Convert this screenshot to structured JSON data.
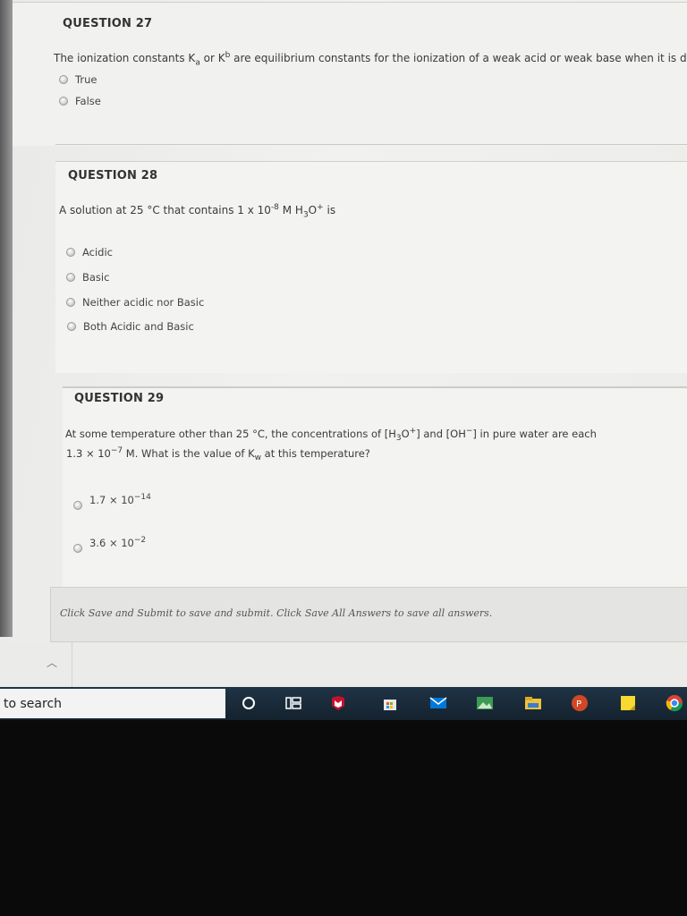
{
  "q27": {
    "title": "QUESTION 27",
    "text_a": "The ionization constants K",
    "sub_a": "a",
    "text_or": " or K",
    "sub_b": "b",
    "text_b": " are equilibrium constants for the ionization of a weak  acid or weak base when it is dissolv",
    "options": [
      "True",
      "False"
    ]
  },
  "q28": {
    "title": "QUESTION 28",
    "text_a": "A solution at 25 °C that contains 1 x 10",
    "exp": "-8",
    "text_b": "  M H",
    "sub": "3",
    "text_c": "O",
    "sup": "+",
    "text_d": " is",
    "options": [
      "Acidic",
      "Basic",
      "Neither acidic nor Basic",
      "Both Acidic and Basic"
    ]
  },
  "q29": {
    "title": "QUESTION 29",
    "line1_a": "At some temperature other than 25 °C, the concentrations of [H",
    "line1_sub": "3",
    "line1_b": "O",
    "line1_sup": "+",
    "line1_c": "] and [OH",
    "line1_sup2": "−",
    "line1_d": "] in pure water are each",
    "line2_a": "1.3 × 10",
    "line2_exp": "−7",
    "line2_b": " M. What is the value of K",
    "line2_sub": "w",
    "line2_c": " at this temperature?",
    "options": [
      {
        "base": "1.7 × 10",
        "exp": "−14"
      },
      {
        "base": "3.6 × 10",
        "exp": "−2"
      }
    ]
  },
  "footer": {
    "save_text": "Click Save and Submit to save and submit. Click Save All Answers to save all answers."
  },
  "taskbar": {
    "search_text": "to search",
    "icons": [
      "cortana-icon",
      "task-view-icon",
      "mcafee-icon",
      "store-icon",
      "mail-icon",
      "photos-icon",
      "file-explorer-icon",
      "powerpoint-icon",
      "sticky-notes-icon",
      "chrome-icon"
    ]
  },
  "colors": {
    "taskbar": "#1a2a38",
    "page_background": "#f1f1ef"
  }
}
